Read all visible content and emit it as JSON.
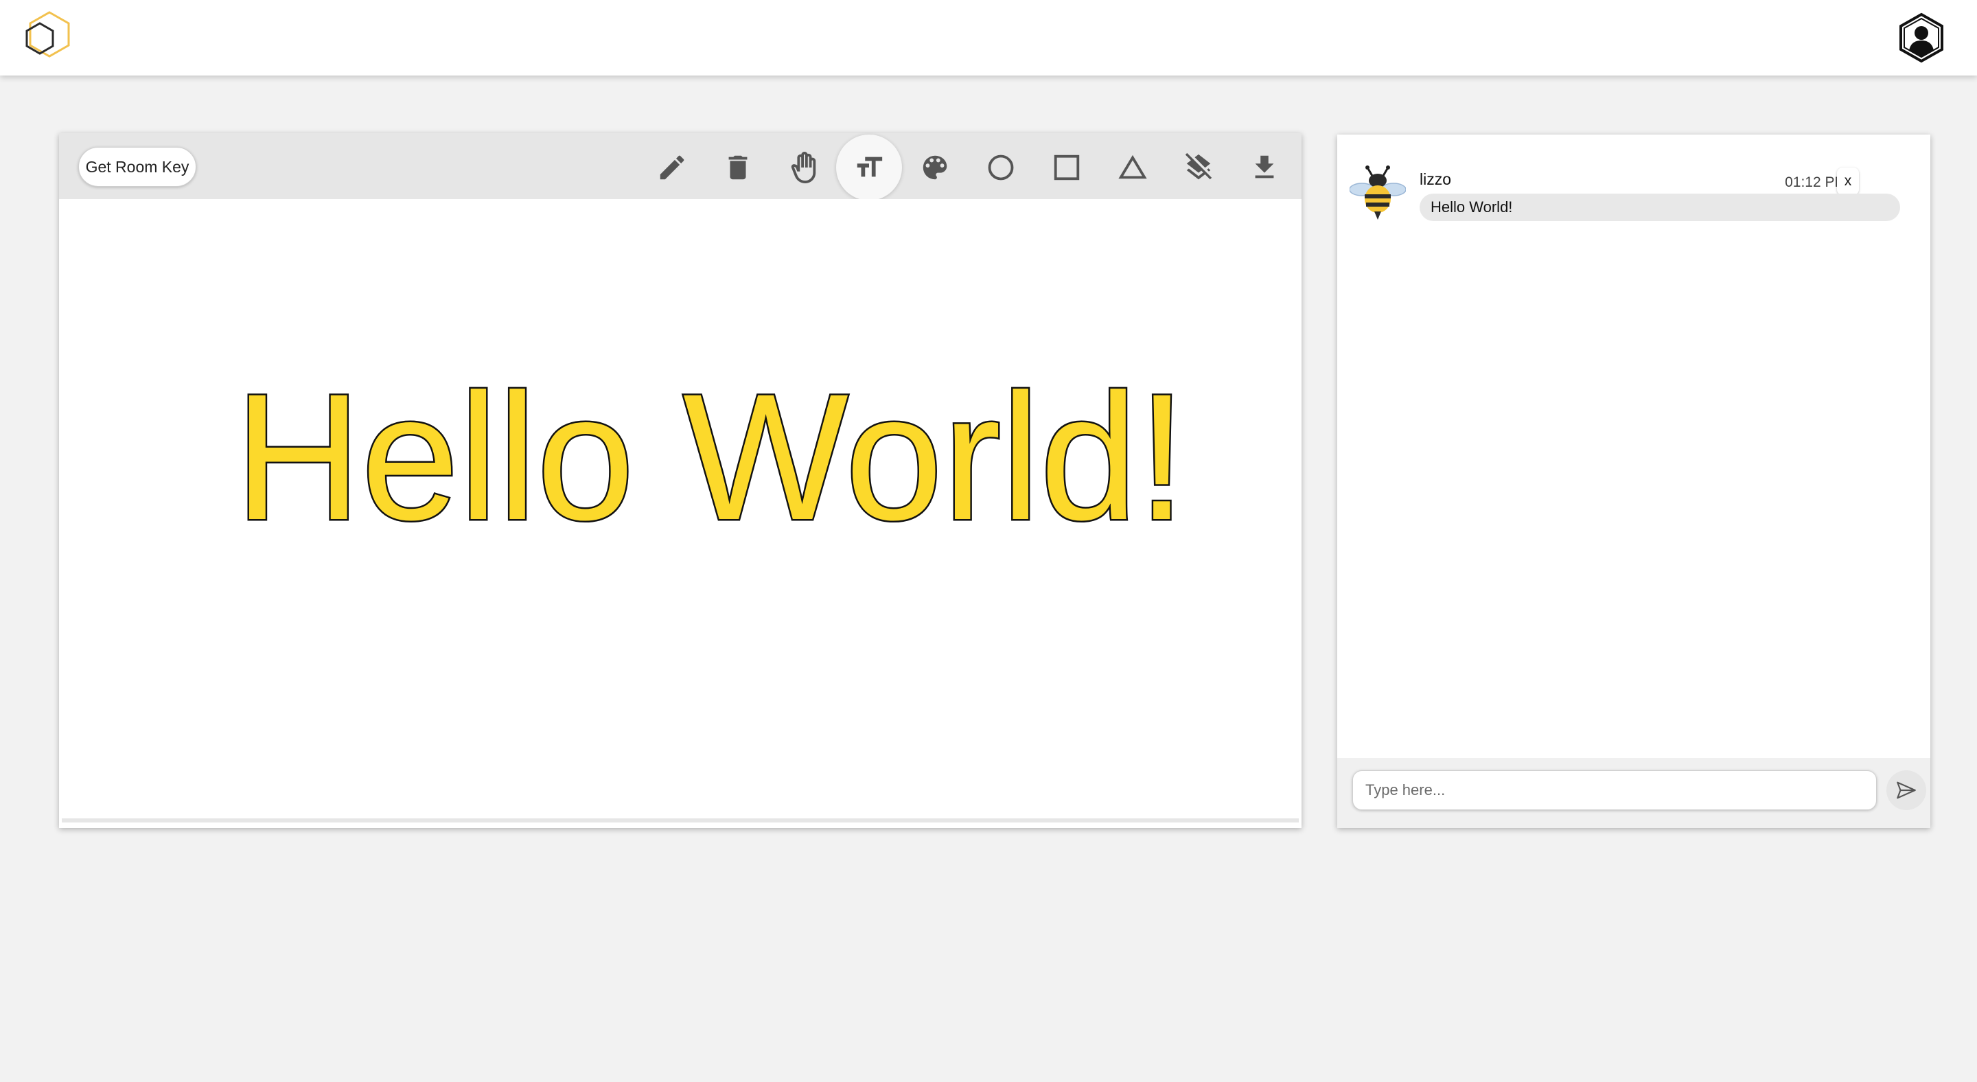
{
  "header": {
    "logo_icon": "hexagon-logo-icon",
    "account_icon": "user-hexagon-icon"
  },
  "board": {
    "room_key_label": "Get Room Key",
    "tools": [
      {
        "name": "pencil-icon"
      },
      {
        "name": "trash-icon"
      },
      {
        "name": "hand-icon"
      },
      {
        "name": "text-size-icon",
        "active": true
      },
      {
        "name": "palette-icon"
      },
      {
        "name": "circle-icon"
      },
      {
        "name": "square-icon"
      },
      {
        "name": "triangle-icon"
      },
      {
        "name": "layers-clear-icon"
      },
      {
        "name": "download-icon"
      }
    ],
    "canvas_text": "Hello World!",
    "canvas_text_fill": "#fcd92b",
    "canvas_text_stroke": "#111111",
    "toolbar_color": "#e6e6e6"
  },
  "chat": {
    "messages": [
      {
        "user": "lizzo",
        "time": "01:12 PM",
        "text": "Hello World!",
        "close_label": "x",
        "avatar_icon": "bee-avatar-icon"
      }
    ],
    "input_placeholder": "Type here...",
    "input_value": "",
    "send_icon": "send-icon"
  },
  "colors": {
    "background": "#f2f2f2",
    "logo_accent": "#f2c14e"
  }
}
